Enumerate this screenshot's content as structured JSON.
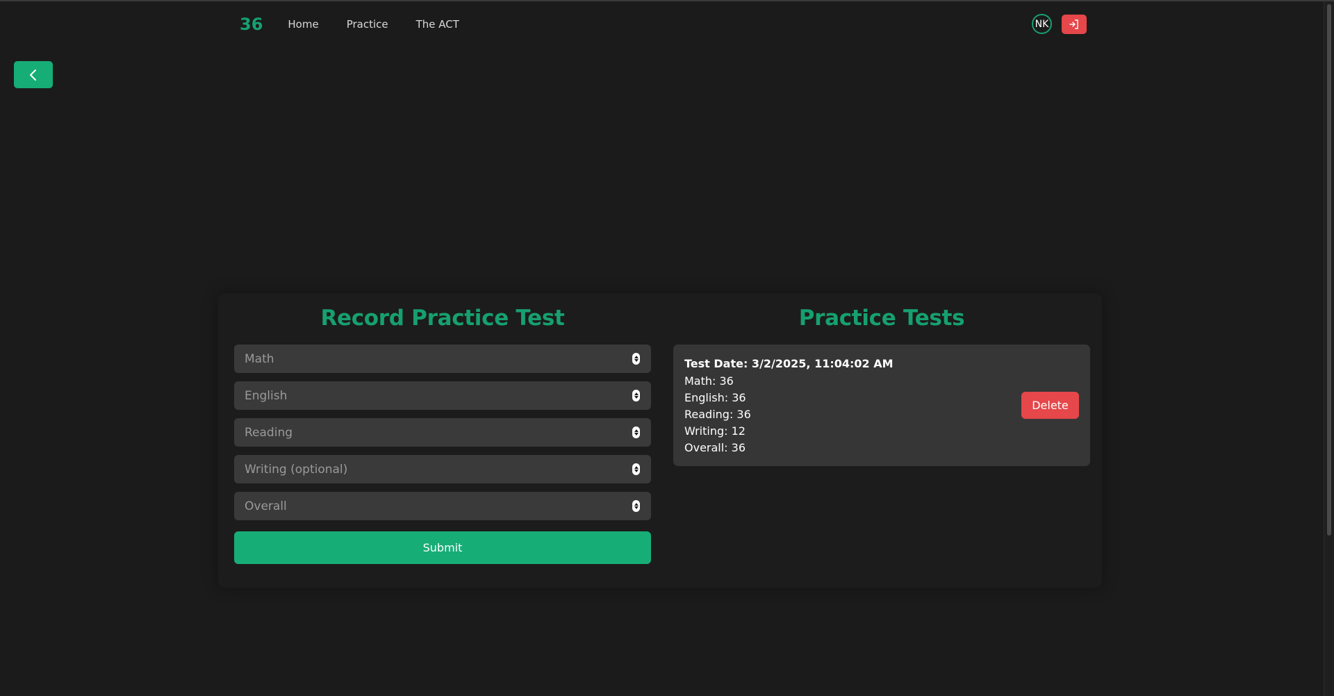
{
  "colors": {
    "background": "#1b1b1b",
    "accent": "#16a070",
    "accent_button": "#17ad77",
    "danger": "#e5474a",
    "input_bg": "#3a3a3a",
    "card_bg": "#363636"
  },
  "header": {
    "logo": "36",
    "nav_links": [
      "Home",
      "Practice",
      "The ACT"
    ],
    "avatar_initials": "NK",
    "logout_icon": "logout-icon"
  },
  "back_button": {
    "icon": "chevron-left-icon"
  },
  "record_form": {
    "title": "Record Practice Test",
    "fields": [
      {
        "placeholder": "Math",
        "value": ""
      },
      {
        "placeholder": "English",
        "value": ""
      },
      {
        "placeholder": "Reading",
        "value": ""
      },
      {
        "placeholder": "Writing (optional)",
        "value": ""
      },
      {
        "placeholder": "Overall",
        "value": ""
      }
    ],
    "submit_label": "Submit"
  },
  "practice_tests": {
    "title": "Practice Tests",
    "items": [
      {
        "date_line": "Test Date: 3/2/2025, 11:04:02 AM",
        "math": "Math: 36",
        "english": "English: 36",
        "reading": "Reading: 36",
        "writing": "Writing: 12",
        "overall": "Overall: 36",
        "delete_label": "Delete"
      }
    ]
  }
}
